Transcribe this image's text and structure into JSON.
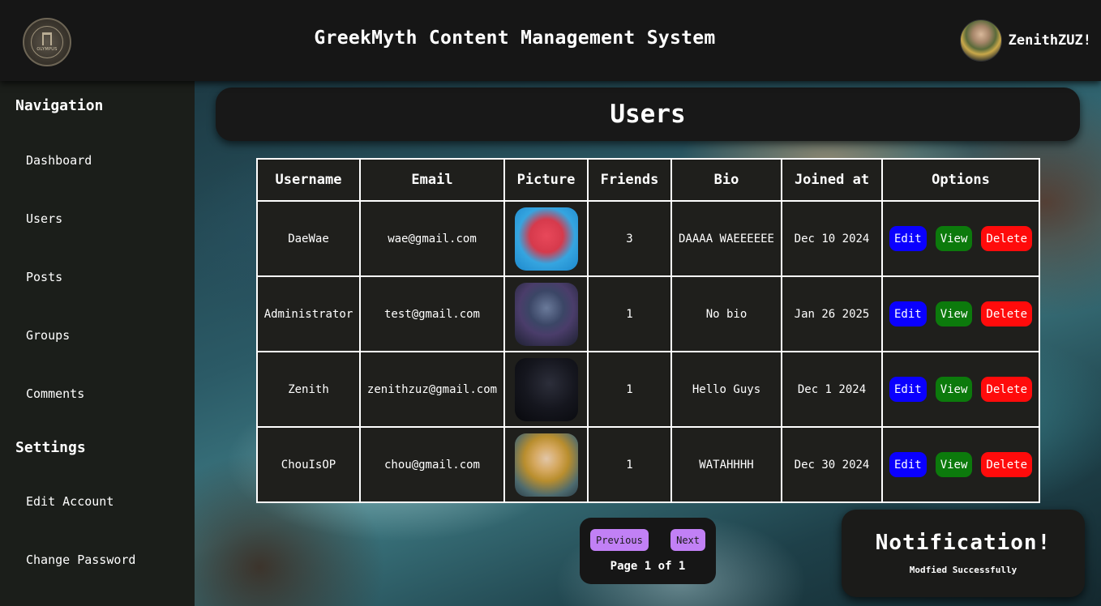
{
  "header": {
    "logo_text": "OLYMPUS",
    "title": "GreekMyth Content Management System",
    "username": "ZenithZUZ!"
  },
  "sidebar": {
    "navigation_heading": "Navigation",
    "nav_items": [
      "Dashboard",
      "Users",
      "Posts",
      "Groups",
      "Comments"
    ],
    "settings_heading": "Settings",
    "settings_items": [
      "Edit Account",
      "Change Password"
    ]
  },
  "page": {
    "title": "Users"
  },
  "table": {
    "headers": [
      "Username",
      "Email",
      "Picture",
      "Friends",
      "Bio",
      "Joined at",
      "Options"
    ],
    "rows": [
      {
        "username": "DaeWae",
        "email": "wae@gmail.com",
        "friends": "3",
        "bio": "DAAAA WAEEEEEE",
        "joined": "Dec 10 2024"
      },
      {
        "username": "Administrator",
        "email": "test@gmail.com",
        "friends": "1",
        "bio": "No bio",
        "joined": "Jan 26 2025"
      },
      {
        "username": "Zenith",
        "email": "zenithzuz@gmail.com",
        "friends": "1",
        "bio": "Hello Guys",
        "joined": "Dec 1 2024"
      },
      {
        "username": "ChouIsOP",
        "email": "chou@gmail.com",
        "friends": "1",
        "bio": "WATAHHHH",
        "joined": "Dec 30 2024"
      }
    ],
    "option_labels": {
      "edit": "Edit",
      "view": "View",
      "delete": "Delete"
    }
  },
  "pagination": {
    "previous_label": "Previous",
    "next_label": "Next",
    "page_info": "Page 1 of 1"
  },
  "notification": {
    "title": "Notification!",
    "message": "Modfied Successfully"
  },
  "colors": {
    "edit": "#0a00ff",
    "view": "#0c7a0c",
    "delete": "#ff0b0b",
    "pager_button": "#c180f5"
  }
}
